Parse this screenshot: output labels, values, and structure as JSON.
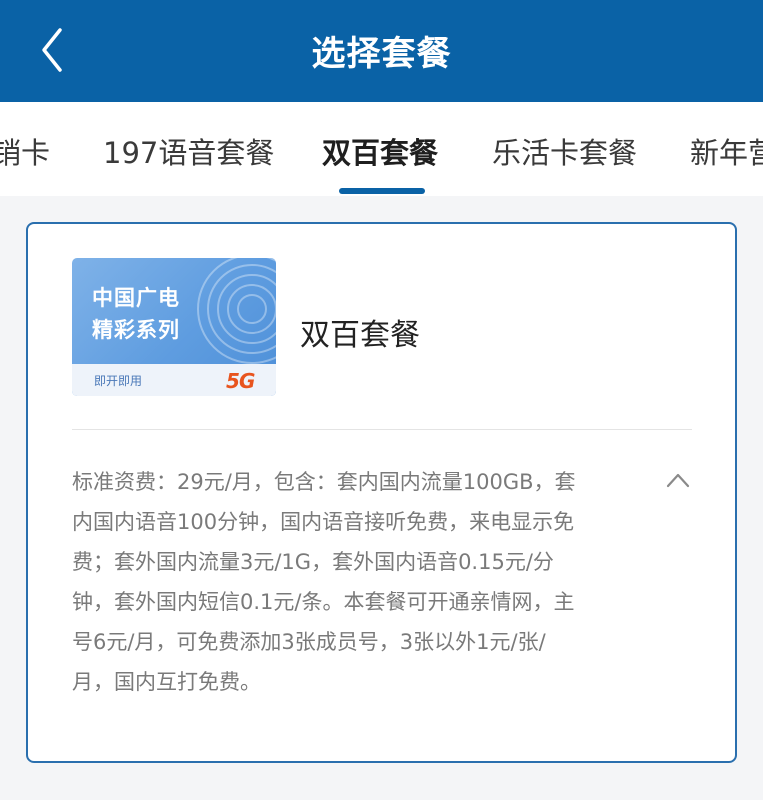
{
  "header": {
    "title": "选择套餐"
  },
  "tabs": [
    {
      "label": "销卡"
    },
    {
      "label": "197语音套餐"
    },
    {
      "label": "双百套餐"
    },
    {
      "label": "乐活卡套餐"
    },
    {
      "label": "新年营"
    }
  ],
  "active_tab_index": 2,
  "plan": {
    "name": "双百套餐",
    "sim_card": {
      "line1": "中国广电",
      "line2": "精彩系列",
      "footer": "即开即用",
      "badge": "5G"
    },
    "description_lines": [
      "标准资费：29元/月，包含：套内国内流量100GB，套",
      "内国内语音100分钟，国内语音接听免费，来电显示免",
      "费；套外国内流量3元/1G，套外国内语音0.15元/分",
      "钟，套外国内短信0.1元/条。本套餐可开通亲情网，主",
      "号6元/月，可免费添加3张成员号，3张以外1元/张/",
      "月，国内互打免费。"
    ]
  },
  "icons": {
    "back": "chevron-left-icon",
    "collapse": "chevron-up-icon"
  },
  "colors": {
    "brand": "#0a62a6",
    "card_border": "#2a6fae",
    "description_text": "#7a7a7a"
  }
}
